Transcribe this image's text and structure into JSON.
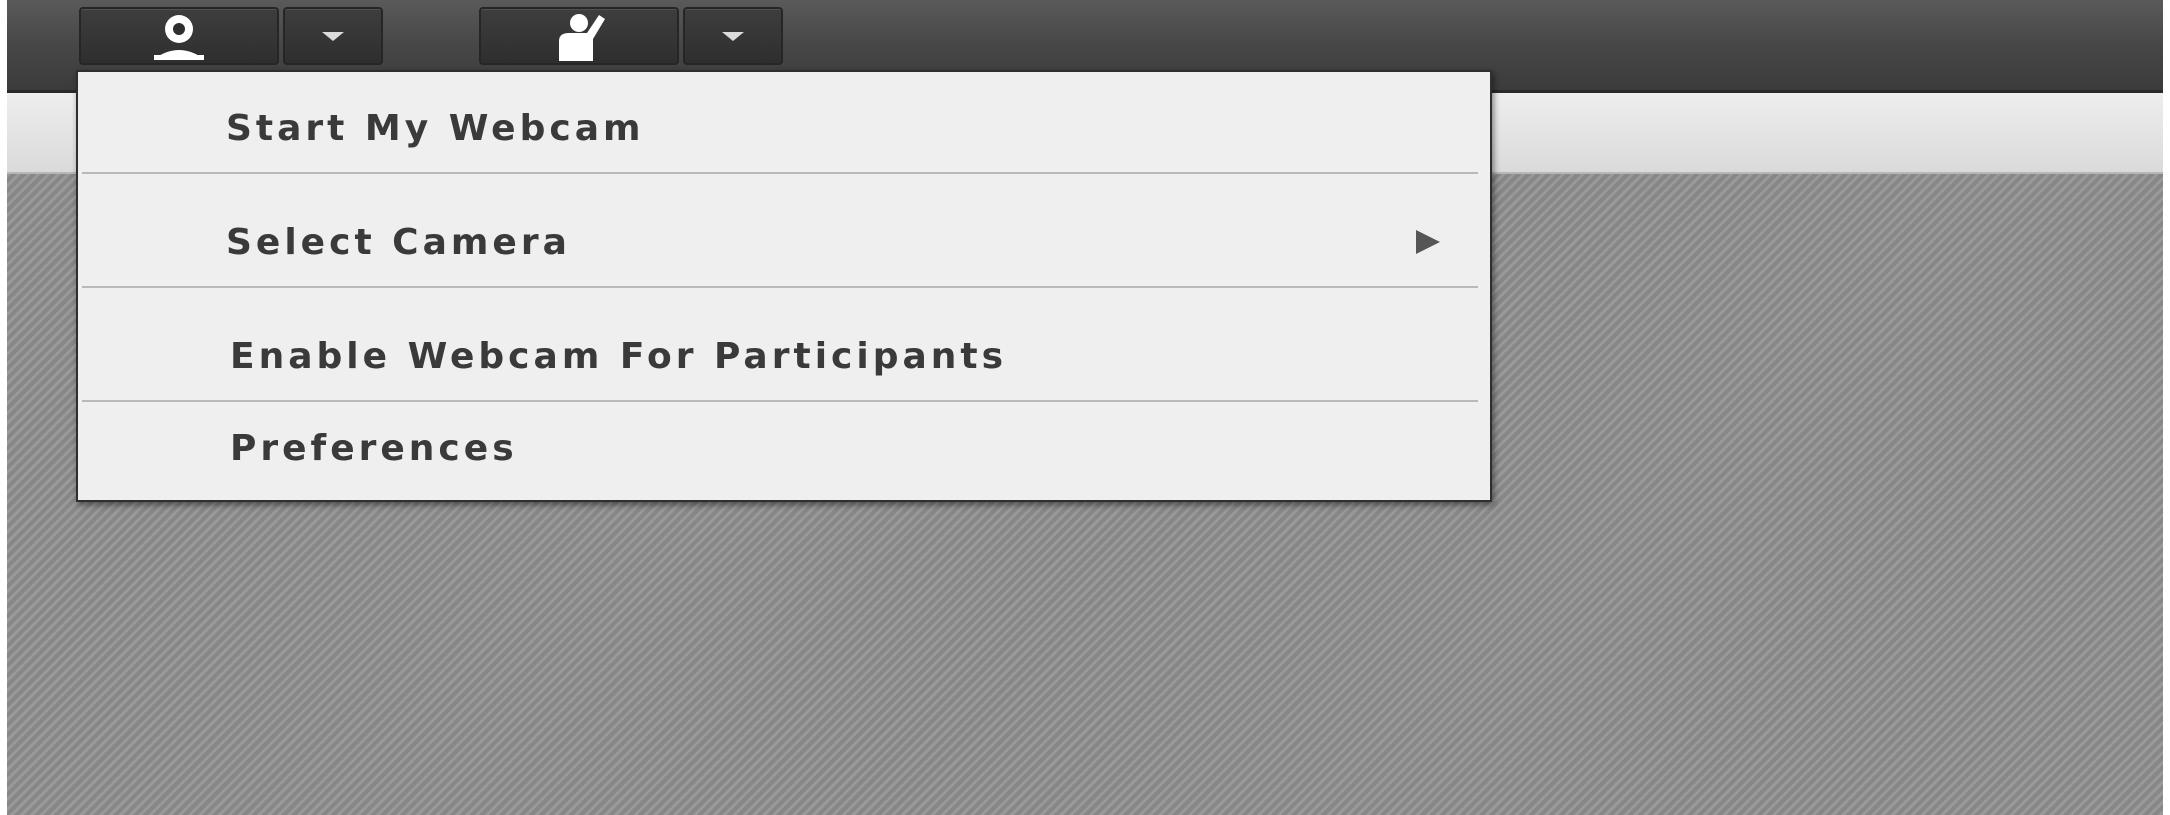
{
  "toolbar": {
    "buttons": [
      {
        "name": "webcam-button",
        "icon": "webcam-icon"
      },
      {
        "name": "webcam-menu-button",
        "icon": "chevron-down-icon"
      },
      {
        "name": "raise-hand-button",
        "icon": "raise-hand-icon"
      },
      {
        "name": "raise-hand-menu-button",
        "icon": "chevron-down-icon"
      }
    ]
  },
  "menu": {
    "items": [
      {
        "label": "Start My Webcam",
        "has_submenu": false
      },
      {
        "label": "Select Camera",
        "has_submenu": true
      },
      {
        "label": "Enable Webcam For Participants",
        "has_submenu": false
      },
      {
        "label": "Preferences",
        "has_submenu": false
      }
    ],
    "submenu_arrow_icon": "caret-right-icon"
  },
  "colors": {
    "toolbar": "#474747",
    "menu_background": "#efefef",
    "menu_text": "#3a3a3a",
    "content_stripes": "#8e8e8e"
  }
}
